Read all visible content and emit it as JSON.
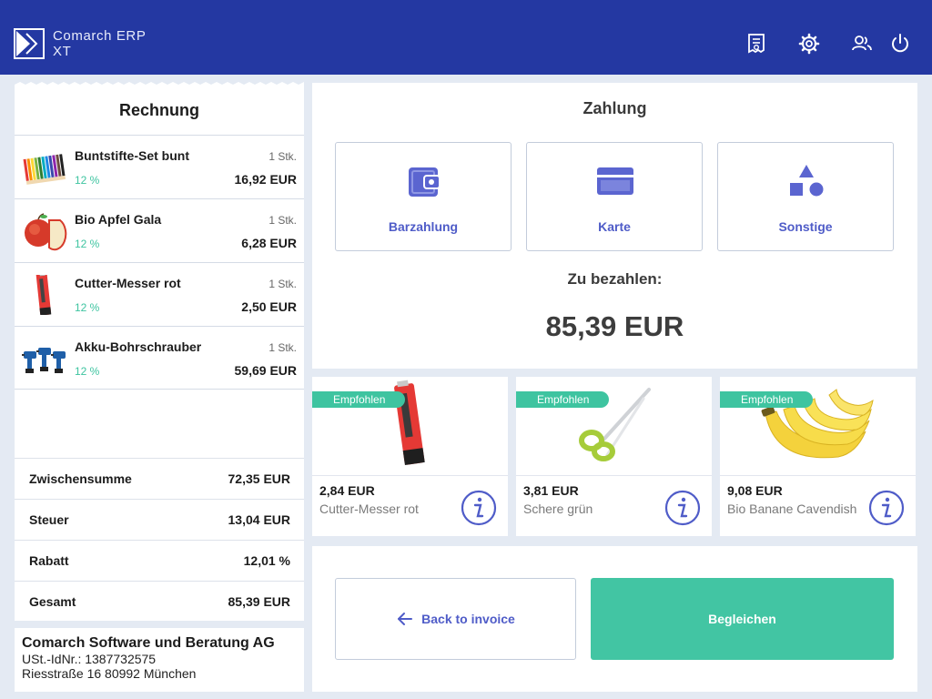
{
  "header": {
    "brand_line1": "Comarch ERP",
    "brand_line2": "XT",
    "icons": [
      "receipt-icon",
      "gear-icon",
      "users-icon",
      "power-icon"
    ],
    "bg_color": "#2438a2"
  },
  "invoice": {
    "title": "Rechnung",
    "items": [
      {
        "name": "Buntstifte-Set bunt",
        "qty": "1 Stk.",
        "tax": "12 %",
        "price": "16,92 EUR",
        "icon": "colored-pencils-icon"
      },
      {
        "name": "Bio Apfel Gala",
        "qty": "1 Stk.",
        "tax": "12 %",
        "price": "6,28 EUR",
        "icon": "apple-icon"
      },
      {
        "name": "Cutter-Messer rot",
        "qty": "1 Stk.",
        "tax": "12 %",
        "price": "2,50 EUR",
        "icon": "cutter-knife-icon"
      },
      {
        "name": "Akku-Bohrschrauber",
        "qty": "1 Stk.",
        "tax": "12 %",
        "price": "59,69 EUR",
        "icon": "drill-icon"
      }
    ],
    "totals": [
      {
        "label": "Zwischensumme",
        "value": "72,35 EUR"
      },
      {
        "label": "Steuer",
        "value": "13,04 EUR"
      },
      {
        "label": "Rabatt",
        "value": "12,01 %"
      },
      {
        "label": "Gesamt",
        "value": "85,39 EUR"
      }
    ]
  },
  "company": {
    "name": "Comarch Software und Beratung AG",
    "vat": "USt.-IdNr.: 1387732575",
    "address": "Riesstraße 16 80992 München"
  },
  "payment": {
    "title": "Zahlung",
    "methods": [
      {
        "label": "Barzahlung",
        "icon": "wallet-icon"
      },
      {
        "label": "Karte",
        "icon": "credit-card-icon"
      },
      {
        "label": "Sonstige",
        "icon": "shapes-icon"
      }
    ],
    "due_label": "Zu bezahlen:",
    "due_amount": "85,39 EUR"
  },
  "recommendations": [
    {
      "badge": "Empfohlen",
      "price": "2,84 EUR",
      "name": "Cutter-Messer rot",
      "icon": "cutter-knife-icon"
    },
    {
      "badge": "Empfohlen",
      "price": "3,81 EUR",
      "name": "Schere grün",
      "icon": "scissors-icon"
    },
    {
      "badge": "Empfohlen",
      "price": "9,08 EUR",
      "name": "Bio Banane Cavendish",
      "icon": "banana-icon"
    }
  ],
  "actions": {
    "back_label": "Back to invoice",
    "settle_label": "Begleichen"
  },
  "colors": {
    "accent": "#4f5cc8",
    "green": "#42c5a3",
    "header": "#2438a2"
  }
}
